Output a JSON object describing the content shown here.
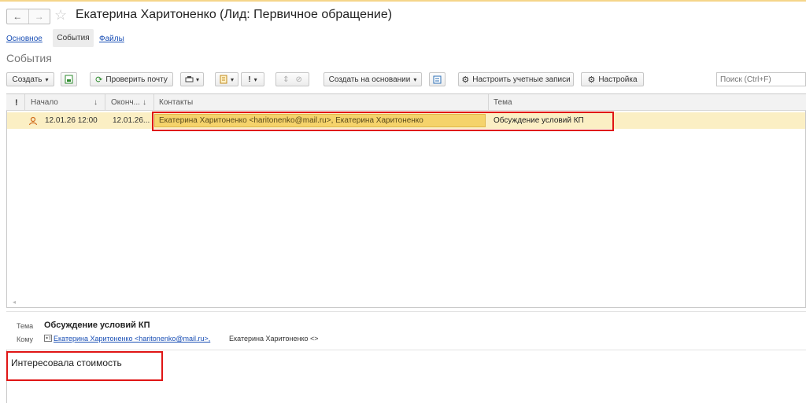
{
  "window": {
    "title": "Екатерина Харитоненко (Лид: Первичное обращение)",
    "back_icon": "←",
    "forward_icon": "→",
    "star_icon": "☆"
  },
  "tabs": [
    {
      "label": "Основное"
    },
    {
      "label": "События"
    },
    {
      "label": "Файлы"
    }
  ],
  "section_title": "События",
  "toolbar": {
    "create_label": "Создать",
    "check_mail_label": "Проверить почту",
    "create_based_label": "Создать на основании",
    "accounts_label": "Настроить учетные записи",
    "settings_label": "Настройка",
    "search_placeholder": "Поиск (Ctrl+F)",
    "excl_label": "!",
    "dd": "▾"
  },
  "table": {
    "columns": {
      "importance": "!",
      "start": "Начало",
      "end": "Оконч...",
      "contacts": "Контакты",
      "subject": "Тема"
    },
    "sort_icon": "↓",
    "rows": [
      {
        "start": "12.01.26 12:00",
        "end": "12.01.26...",
        "contacts": "Екатерина Харитоненко <haritonenko@mail.ru>, Екатерина Харитоненко",
        "subject": "Обсуждение условий КП"
      }
    ]
  },
  "preview": {
    "subject_label": "Тема",
    "subject_value": "Обсуждение условий КП",
    "to_label": "Кому",
    "to_link": "Екатерина Харитоненко <haritonenko@mail.ru>,",
    "to_text": "Екатерина Харитоненко <>",
    "body": "Интересовала стоимость"
  }
}
